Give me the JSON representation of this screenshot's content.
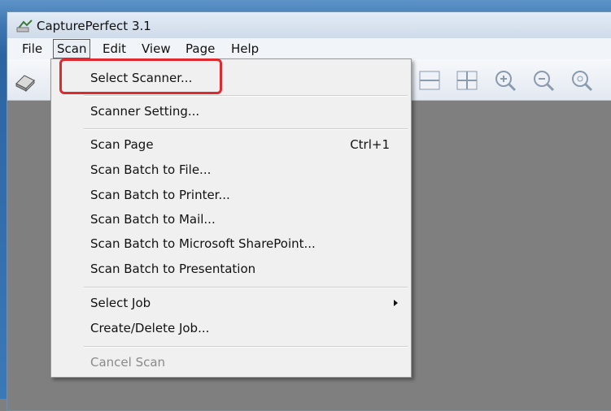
{
  "window": {
    "title": "CapturePerfect 3.1"
  },
  "menubar": {
    "items": [
      {
        "label": "File"
      },
      {
        "label": "Scan"
      },
      {
        "label": "Edit"
      },
      {
        "label": "View"
      },
      {
        "label": "Page"
      },
      {
        "label": "Help"
      }
    ]
  },
  "scan_menu": {
    "items": [
      {
        "label": "Select Scanner..."
      },
      {
        "label": "Scanner Setting..."
      },
      {
        "label": "Scan Page",
        "shortcut": "Ctrl+1"
      },
      {
        "label": "Scan Batch to File..."
      },
      {
        "label": "Scan Batch to Printer..."
      },
      {
        "label": "Scan Batch to Mail..."
      },
      {
        "label": "Scan Batch to Microsoft SharePoint..."
      },
      {
        "label": "Scan Batch to Presentation"
      },
      {
        "label": "Select Job"
      },
      {
        "label": "Create/Delete Job..."
      },
      {
        "label": "Cancel Scan",
        "disabled": true
      }
    ]
  },
  "toolbar": {
    "icons": [
      "scanner-icon",
      "fit-width-icon",
      "fit-page-icon",
      "zoom-in-icon",
      "zoom-out-icon",
      "zoom-100-icon"
    ]
  },
  "colors": {
    "highlight": "#e0282f"
  }
}
